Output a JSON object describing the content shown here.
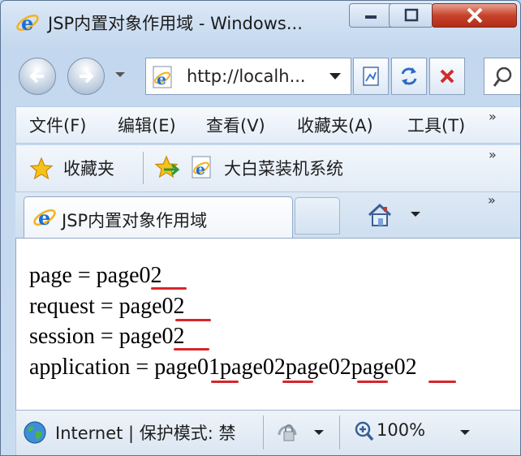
{
  "window": {
    "title": "JSP内置对象作用域 - Windows...",
    "icon": "ie-logo-icon"
  },
  "navigation": {
    "address": "http://localh...",
    "buttons": [
      "back-icon",
      "forward-icon",
      "compatibility-icon",
      "refresh-icon",
      "stop-icon",
      "search-icon"
    ]
  },
  "menubar": {
    "items": [
      "文件(F)",
      "编辑(E)",
      "查看(V)",
      "收藏夹(A)",
      "工具(T)"
    ],
    "overflow": "»"
  },
  "favorites_bar": {
    "label": "收藏夹",
    "link": "大白菜装机系统",
    "overflow": "»"
  },
  "tabs": {
    "active": "JSP内置对象作用域",
    "overflow": "»"
  },
  "content": {
    "lines": [
      "page = page02",
      "request = page02",
      "session = page02",
      "application = page01page02page02page02"
    ],
    "underline_color": "#d7262b"
  },
  "statusbar": {
    "zone": "Internet | 保护模式: 禁",
    "zoom": "100%"
  }
}
